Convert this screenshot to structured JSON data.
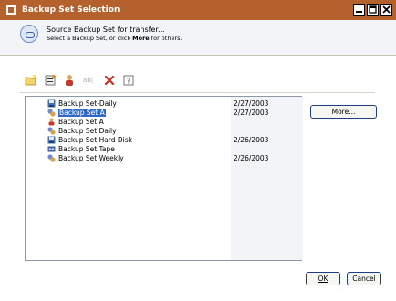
{
  "window": {
    "title": "Backup Set Selection"
  },
  "header": {
    "title": "Source Backup Set for transfer...",
    "subtitle_prefix": "Select a Backup Set, or click ",
    "subtitle_bold": "More",
    "subtitle_suffix": " for others."
  },
  "toolbar": {
    "items": [
      "new-folder-icon",
      "properties-icon",
      "user-icon",
      "rename-icon",
      "delete-icon",
      "help-icon"
    ],
    "rename_text": "ab|"
  },
  "list": {
    "rows": [
      {
        "name": "Backup Set-Daily",
        "date": "2/27/2003",
        "icon": "disk-icon"
      },
      {
        "name": "Backup Set A",
        "date": "2/27/2003",
        "icon": "backup-set-icon",
        "selected": true
      },
      {
        "name": "Backup Set A",
        "date": "",
        "icon": "user-backup-icon"
      },
      {
        "name": "Backup Set Daily",
        "date": "",
        "icon": "backup-set-icon"
      },
      {
        "name": "Backup Set Hard Disk",
        "date": "2/26/2003",
        "icon": "disk-icon"
      },
      {
        "name": "Backup Set Tape",
        "date": "",
        "icon": "tape-icon"
      },
      {
        "name": "Backup Set Weekly",
        "date": "2/26/2003",
        "icon": "backup-set-icon"
      }
    ]
  },
  "buttons": {
    "more": "More...",
    "ok": "OK",
    "cancel": "Cancel"
  },
  "colors": {
    "titlebar": "#b5612d",
    "selection": "#3169c6",
    "delete": "#d42b1e"
  }
}
